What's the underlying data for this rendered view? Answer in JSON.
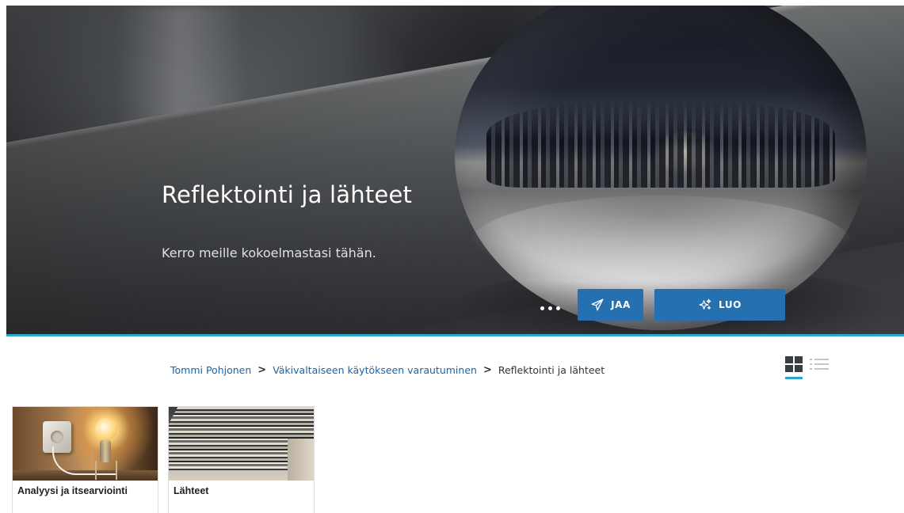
{
  "hero": {
    "title": "Reflektointi ja lähteet",
    "subtitle": "Kerro meille kokoelmastasi tähän.",
    "more_icon": "more-horizontal-icon",
    "share_label": "JAA",
    "share_icon": "paper-plane-icon",
    "create_label": "LUO",
    "create_icon": "sparkle-icon",
    "accent_color": "#2570b0",
    "divider_color": "#2aa7c9"
  },
  "breadcrumb": {
    "items": [
      {
        "label": "Tommi Pohjonen",
        "link": true
      },
      {
        "label": "Väkivaltaiseen käytökseen varautuminen",
        "link": true
      },
      {
        "label": "Reflektointi ja lähteet",
        "link": false
      }
    ],
    "separator": ">"
  },
  "view_toggle": {
    "active": "grid",
    "grid_icon": "grid-view-icon",
    "list_icon": "list-view-icon"
  },
  "cards": [
    {
      "title": "Analyysi ja itsearviointi",
      "thumbnail": "light-bulb-figure-image"
    },
    {
      "title": "Lähteet",
      "thumbnail": "file-drawer-image"
    }
  ]
}
